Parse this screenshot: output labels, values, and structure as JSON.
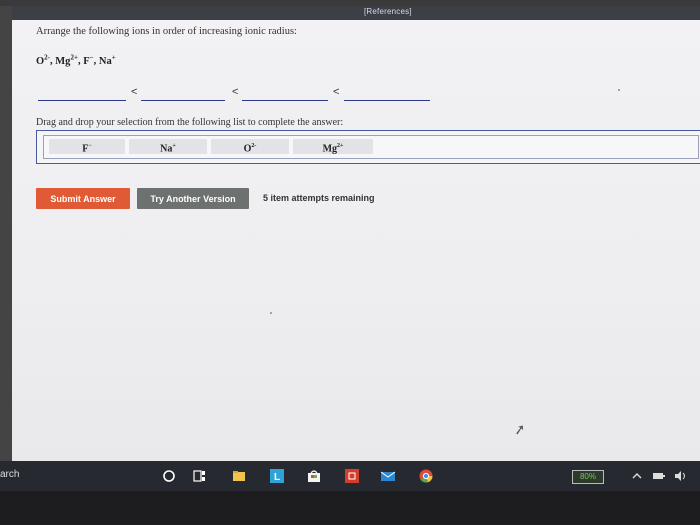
{
  "header": {
    "references_label": "[References]"
  },
  "question": {
    "prompt": "Arrange the following ions in order of increasing ionic radius:",
    "ions": [
      {
        "base": "O",
        "charge": "2-"
      },
      {
        "base": "Mg",
        "charge": "2+"
      },
      {
        "base": "F",
        "charge": "-"
      },
      {
        "base": "Na",
        "charge": "+"
      }
    ],
    "ions_text": "O2-, Mg2+, F-, Na+"
  },
  "answer": {
    "separator": "<"
  },
  "drag": {
    "instruction": "Drag and drop your selection from the following list to complete the answer:",
    "chips": [
      {
        "base": "F",
        "charge": "-"
      },
      {
        "base": "Na",
        "charge": "+"
      },
      {
        "base": "O",
        "charge": "2-"
      },
      {
        "base": "Mg",
        "charge": "2+"
      }
    ]
  },
  "buttons": {
    "submit": "Submit Answer",
    "try_another": "Try Another Version"
  },
  "status": {
    "attempts": "5 item attempts remaining"
  },
  "taskbar": {
    "search_fragment": "arch",
    "battery": "80%",
    "icons": [
      "cortana-circle-icon",
      "task-view-icon",
      "file-explorer-icon",
      "lightroom-icon",
      "store-icon",
      "office-icon",
      "mail-icon",
      "chrome-icon"
    ]
  },
  "colors": {
    "submit_bg": "#e05a36",
    "try_bg": "#6d716f",
    "blank_line": "#2f3a8a",
    "tray_border": "#4a5aa0"
  }
}
